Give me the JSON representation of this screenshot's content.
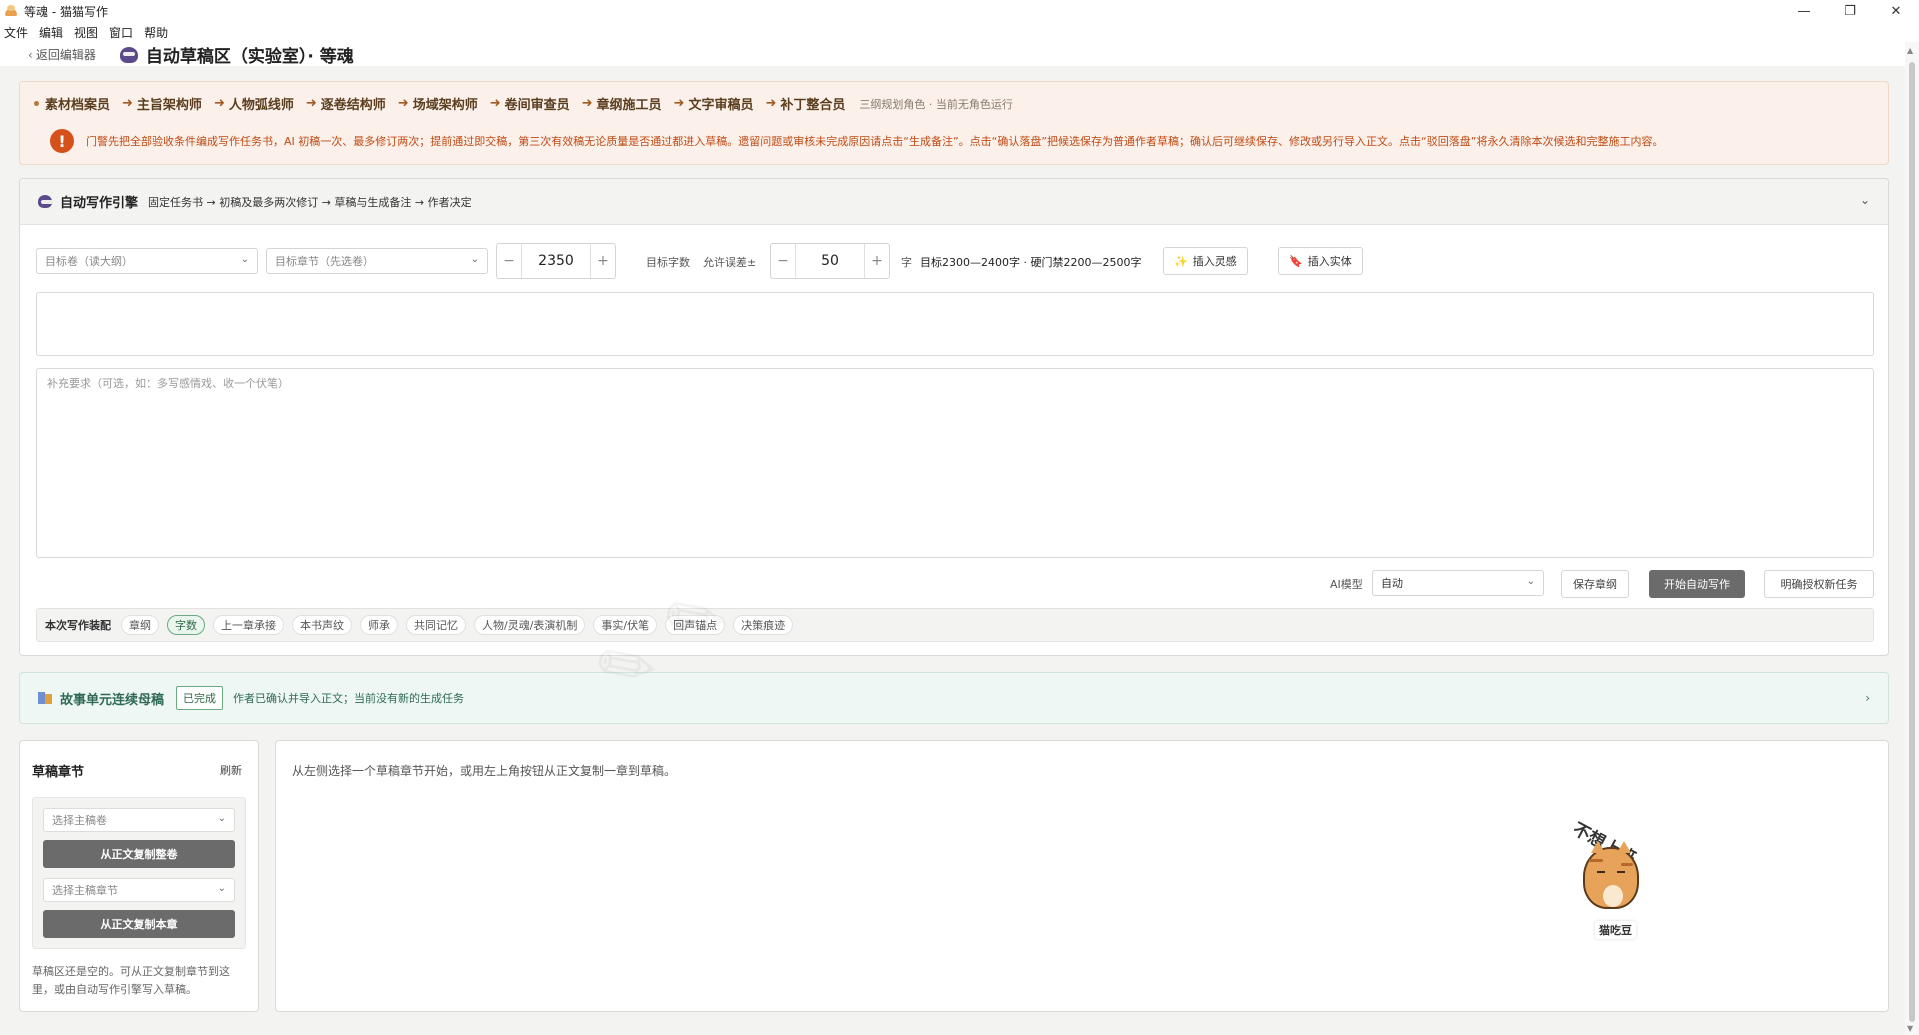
{
  "window": {
    "title": "等魂 - 猫猫写作",
    "minimize": "—",
    "restore": "❐",
    "close": "✕"
  },
  "menu": [
    "文件",
    "编辑",
    "视图",
    "窗口",
    "帮助"
  ],
  "header": {
    "back_label": "返回编辑器",
    "page_title": "自动草稿区（实验室）· 等魂"
  },
  "pipeline": {
    "steps": [
      "素材档案员",
      "主旨架构师",
      "人物弧线师",
      "逐卷结构师",
      "场域架构师",
      "卷间审查员",
      "章纲施工员",
      "文字审稿员",
      "补丁整合员"
    ],
    "note": "三纲规划角色 · 当前无角色运行",
    "warning_icon": "!",
    "warning": "门警先把全部验收条件编成写作任务书，AI 初稿一次、最多修订两次；提前通过即交稿，第三次有效稿无论质量是否通过都进入草稿。遗留问题或审核未完成原因请点击“生成备注”。点击“确认落盘”把候选保存为普通作者草稿；确认后可继续保存、修改或另行导入正文。点击“驳回落盘”将永久清除本次候选和完整施工内容。"
  },
  "engine": {
    "title": "自动写作引擎",
    "subtitle": "固定任务书 → 初稿及最多两次修订 → 草稿与生成备注 → 作者决定",
    "volume_placeholder": "目标卷（读大纲）",
    "chapter_placeholder": "目标章节（先选卷）",
    "target_words": "2350",
    "target_words_label": "目标字数",
    "tolerance_label": "允许误差±",
    "tolerance": "50",
    "unit": "字",
    "target_range": "目标2300—2400字 · 硬门禁2200—2500字",
    "insert_inspiration": "插入灵感",
    "insert_entity": "插入实体",
    "extra_placeholder": "补充要求（可选，如：多写感情戏、收一个伏笔）",
    "ai_model_label": "AI模型",
    "ai_model_value": "自动",
    "save_outline": "保存章纲",
    "start_auto_write": "开始自动写作",
    "explicit_new_task": "明确授权新任务",
    "assembly_label": "本次写作装配",
    "assembly_tags": [
      "章纲",
      "字数",
      "上一章承接",
      "本书声纹",
      "师承",
      "共同记忆",
      "人物/灵魂/表演机制",
      "事实/伏笔",
      "回声锚点",
      "决策痕迹"
    ],
    "active_tag_index": 1
  },
  "story_unit": {
    "title": "故事单元连续母稿",
    "badge": "已完成",
    "text": "作者已确认并导入正文；当前没有新的生成任务"
  },
  "drafts": {
    "title": "草稿章节",
    "refresh": "刷新",
    "volume_placeholder": "选择主稿卷",
    "copy_volume": "从正文复制整卷",
    "chapter_placeholder": "选择主稿章节",
    "copy_chapter": "从正文复制本章",
    "empty_text": "草稿区还是空的。可从正文复制章节到这里，或由自动写作引擎写入草稿。"
  },
  "editor": {
    "hint": "从左侧选择一个草稿章节开始，或用左上角按钮从正文复制一章到草稿。"
  },
  "mascot": {
    "speech": "不想上班",
    "name": "猫吃豆"
  },
  "colors": {
    "warning": "#c04a14",
    "accent_green": "#2f6a45",
    "dark_button": "#6b6b6b"
  }
}
